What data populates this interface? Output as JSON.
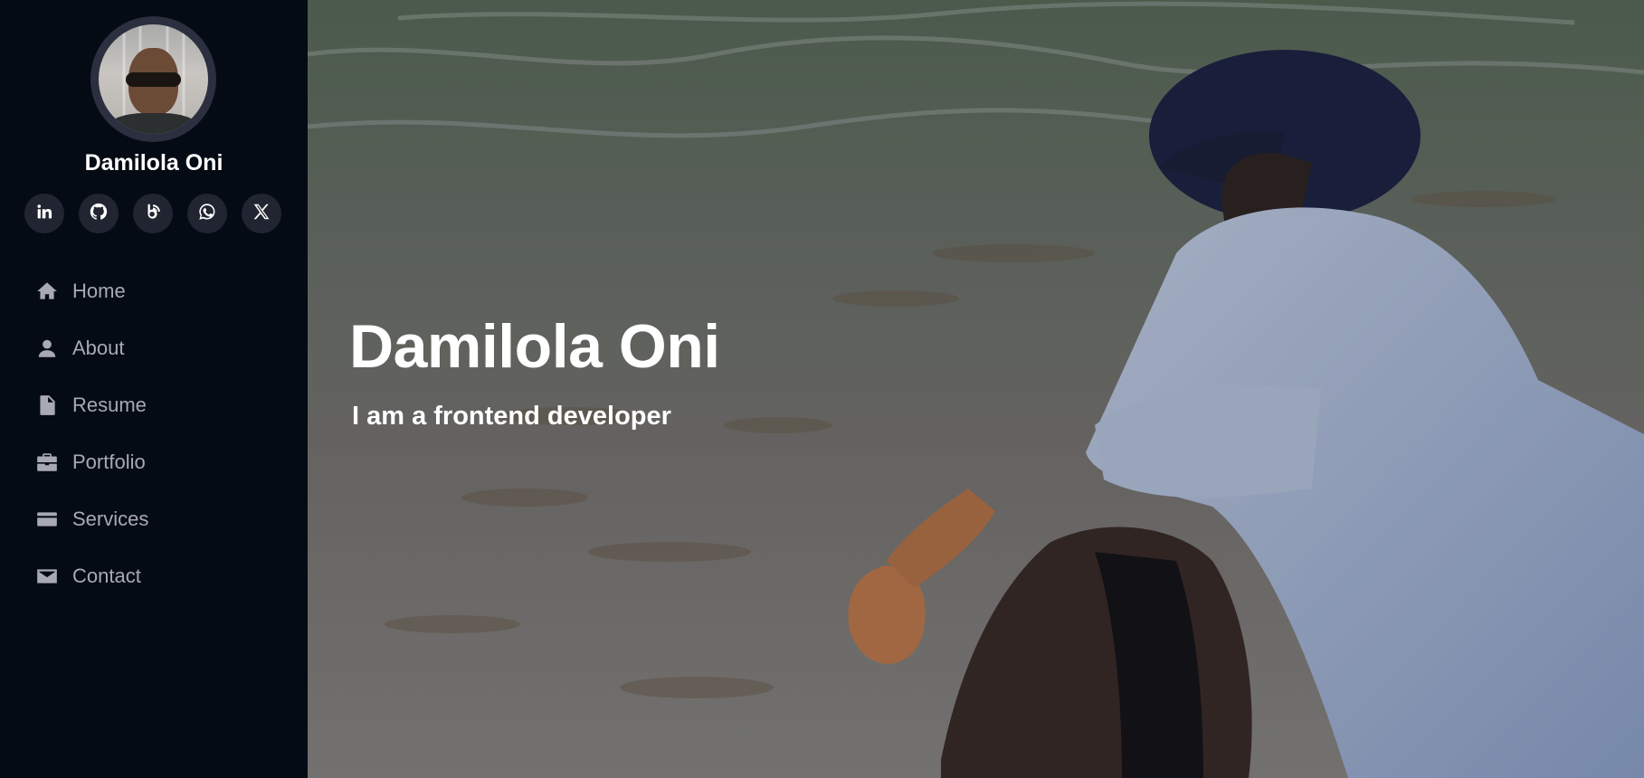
{
  "profile": {
    "name": "Damilola Oni",
    "avatar_icon": "profile-photo"
  },
  "social_links": [
    {
      "name": "linkedin",
      "icon": "linkedin-icon"
    },
    {
      "name": "github",
      "icon": "github-icon"
    },
    {
      "name": "blog",
      "icon": "blog-icon"
    },
    {
      "name": "whatsapp",
      "icon": "whatsapp-icon"
    },
    {
      "name": "x",
      "icon": "x-icon"
    }
  ],
  "nav": {
    "items": [
      {
        "label": "Home",
        "icon": "home-icon"
      },
      {
        "label": "About",
        "icon": "user-icon"
      },
      {
        "label": "Resume",
        "icon": "file-icon"
      },
      {
        "label": "Portfolio",
        "icon": "briefcase-icon"
      },
      {
        "label": "Services",
        "icon": "card-icon"
      },
      {
        "label": "Contact",
        "icon": "envelope-icon"
      }
    ]
  },
  "hero": {
    "title": "Damilola Oni",
    "subtitle": "I am a frontend developer"
  },
  "colors": {
    "sidebar_bg": "#040b14",
    "social_bg": "#212431",
    "nav_text": "#a8a9b4",
    "hero_text": "#ffffff"
  }
}
